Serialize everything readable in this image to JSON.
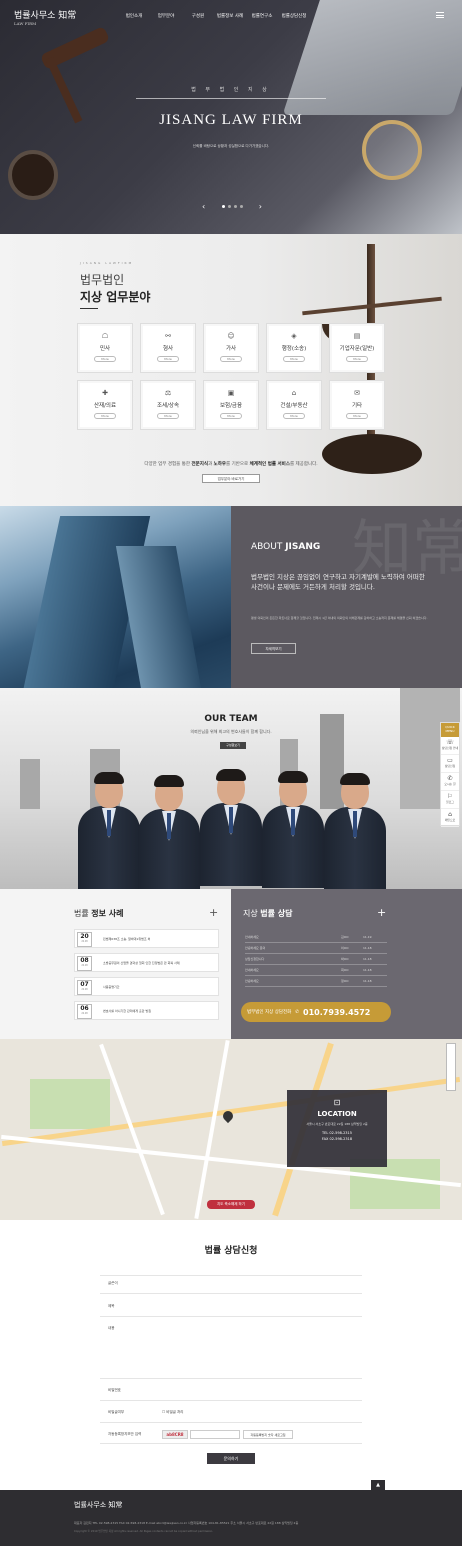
{
  "header": {
    "logo": "법률사무소 知常",
    "logo_sub": "LAW FIRM",
    "nav": [
      "법인소개",
      "업무분야",
      "구성원",
      "법률정보 사례",
      "법률연구소",
      "법률상담신청"
    ]
  },
  "hero": {
    "subtitle": "법 무 법 인  지 상",
    "title": "JISANG LAW FIRM",
    "desc": "신뢰를 바탕으로 상황과 성실함으로 다가가겠습니다.",
    "prev": "‹",
    "next": "›"
  },
  "practice": {
    "eng": "JISANG LAWFIRM",
    "title1": "법무법인",
    "title2": "지상 업무분야",
    "items": [
      {
        "label": "민사",
        "icon": "☖"
      },
      {
        "label": "형사",
        "icon": "⚯"
      },
      {
        "label": "가사",
        "icon": "☺"
      },
      {
        "label": "행정(소송)",
        "icon": "◈"
      },
      {
        "label": "기업자문(일반)",
        "icon": "▤"
      },
      {
        "label": "산재/의료",
        "icon": "✚"
      },
      {
        "label": "조세/상속",
        "icon": "⚖"
      },
      {
        "label": "보험/금융",
        "icon": "▣"
      },
      {
        "label": "건설/부동산",
        "icon": "⌂"
      },
      {
        "label": "기타",
        "icon": "✉"
      }
    ],
    "more": "More",
    "desc_pre": "다양한 업무 경험을 통한 ",
    "desc_b1": "전문지식",
    "desc_mid": "과 ",
    "desc_b2": "노하우",
    "desc_mid2": "를 기반으로 ",
    "desc_b3": "체계적인 법률 서비스",
    "desc_post": "를 제공합니다.",
    "button": "업무분야 바로가기"
  },
  "about": {
    "title_pre": "ABOUT ",
    "title_b": "JISANG",
    "hanja": "知常",
    "para": "법무법인 지상은 끊임없이 연구하고 자기계발에 노력하여 어떠한 사건이나 문제에도 거든하게 처리할 것입니다.",
    "small": "평생 의뢰인의 든든한 파트너로 함께할 것입니다. 전제시 1년 이내의 의뢰인의 이해관계를 감하하고 소송까지 문제를 해결을 신뢰 하겠습니다.",
    "button": "자세히보기"
  },
  "team": {
    "title": "OUR TEAM",
    "sub": "의뢰인님을 위해 최고의 변호사들이 함께 합니다.",
    "button": "구성원보기"
  },
  "sidebar": {
    "header": "QUICK MENU",
    "items": [
      {
        "icon": "☏",
        "label": "상담신청 안내"
      },
      {
        "icon": "▭",
        "label": "상담신청"
      },
      {
        "icon": "✆",
        "label": "오시는 길"
      },
      {
        "icon": "⚐",
        "label": "블로그"
      },
      {
        "icon": "⌂",
        "label": "메인으로"
      }
    ]
  },
  "info": {
    "title_pre": "법률 ",
    "title_b": "정보 사례",
    "plus": "+",
    "cases": [
      {
        "day": "20",
        "date": "20.08",
        "text": "민법제638조 소송, 알바대1위법조 처"
      },
      {
        "day": "08",
        "date": "20.08",
        "text": "소방공무원의 산업을 경과상 철회 인한 진정법은 만 회복 사례"
      },
      {
        "day": "07",
        "date": "20.08",
        "text": "사용증명기간"
      },
      {
        "day": "06",
        "date": "20.08",
        "text": "변호사를 아니기한 관리에게 훈란 방침"
      }
    ]
  },
  "consult": {
    "title_pre": "지상 ",
    "title_b": "법률 상담",
    "plus": "+",
    "rows": [
      {
        "a": "안내하세요",
        "b": "김OO",
        "c": "11.19"
      },
      {
        "a": "안녕하세요 문의",
        "b": "이OO",
        "c": "11.18"
      },
      {
        "a": "상담신청합니다",
        "b": "박OO",
        "c": "11.18"
      },
      {
        "a": "안내하세요",
        "b": "최OO",
        "c": "11.18"
      },
      {
        "a": "안녕하세요",
        "b": "정OO",
        "c": "11.18"
      }
    ],
    "phone_label": "법무법인 지상 상담전화",
    "phone_icon": "✆",
    "phone": "010.7939.4572"
  },
  "location": {
    "icon": "⊡",
    "title": "LOCATION",
    "address": "서울시 서초구 반포대로 22길 188 삼익빌딩 2층",
    "tel": "TEL   02-598-2315",
    "fax": "FAX   02-598-2318",
    "button": "지도 축소해제 하기"
  },
  "form": {
    "title": "법률 상담신청",
    "fields": [
      "글쓴이",
      "제목",
      "내용",
      "비밀번호",
      "비밀글여부",
      "자동등록방지보안 입력"
    ],
    "secret": "☐ 비밀글 처리",
    "captcha": "ab8CR8",
    "captcha_btn": "자동등록방지 숫자 새로고침",
    "submit": "문의하기"
  },
  "footer": {
    "logo": "법률사무소 知常",
    "info": "대표자    김민지         TEL    02-598-2315        FAX    02-598-2318        E-mail    abcd@lawjisan.co.kr        사업자등록번호    104-81-85521        주소    서울시 서초구 반포대로 22길 188 삼익빌딩 2층",
    "copy": "Copyright © 2019 법무법인 지상 All rights reserved. All Pages contents cannot be copied without permission.",
    "top": "▲"
  }
}
